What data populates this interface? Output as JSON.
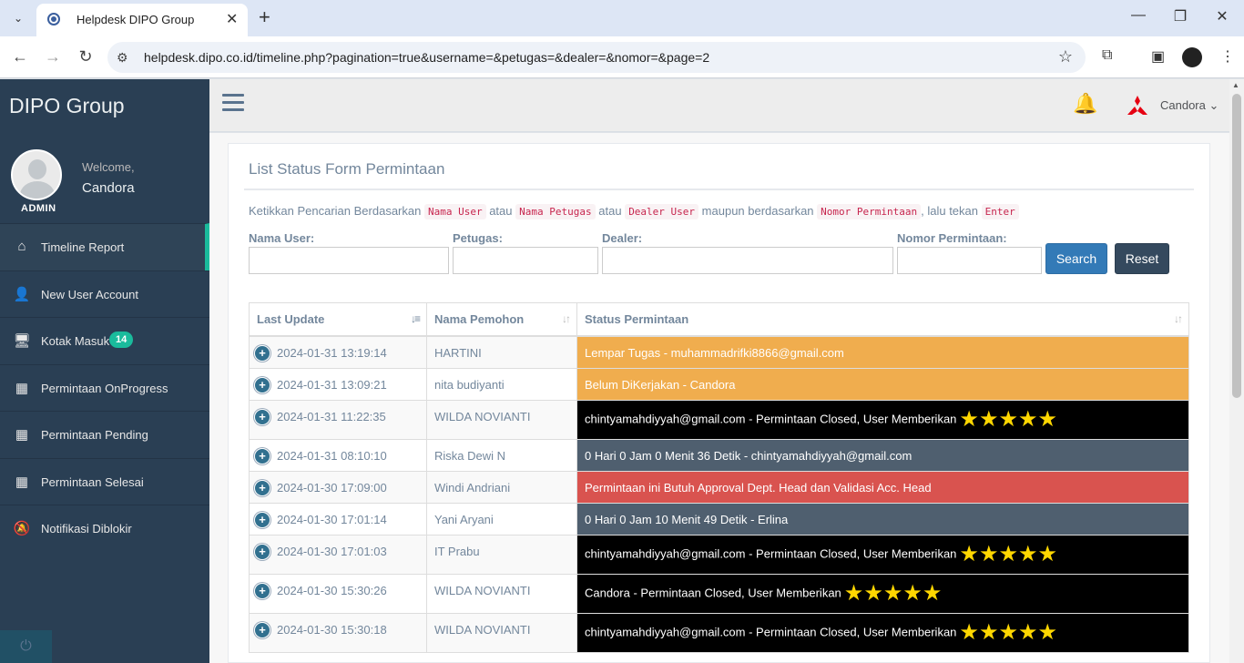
{
  "browser": {
    "tab_title": "Helpdesk DIPO Group",
    "url": "helpdesk.dipo.co.id/timeline.php?pagination=true&username=&petugas=&dealer=&nomor=&page=2"
  },
  "sidebar": {
    "brand": "DIPO Group",
    "welcome": "Welcome,",
    "username": "Candora",
    "role": "ADMIN",
    "items": [
      {
        "label": "Timeline Report",
        "icon": "home-icon",
        "glyph": "⌂"
      },
      {
        "label": "New User Account",
        "icon": "user-plus-icon",
        "glyph": "👤"
      },
      {
        "label": "Kotak Masuk",
        "icon": "desktop-icon",
        "glyph": "🖥",
        "badge": "14"
      },
      {
        "label": "Permintaan OnProgress",
        "icon": "table-icon",
        "glyph": "▦"
      },
      {
        "label": "Permintaan Pending",
        "icon": "table-icon",
        "glyph": "▦"
      },
      {
        "label": "Permintaan Selesai",
        "icon": "table-icon",
        "glyph": "▦"
      },
      {
        "label": "Notifikasi Diblokir",
        "icon": "bell-slash-icon",
        "glyph": "🔕"
      }
    ]
  },
  "topnav": {
    "user": "Candora ⌄"
  },
  "panel": {
    "title": "List Status Form Permintaan",
    "hint_prefix": "Ketikkan Pencarian Berdasarkan",
    "hint_code1": "Nama User",
    "hint_atau1": "atau",
    "hint_code2": "Nama Petugas",
    "hint_atau2": "atau",
    "hint_code3": "Dealer User",
    "hint_maupun": "maupun berdasarkan",
    "hint_code4": "Nomor Permintaan",
    "hint_lalu": ", lalu tekan",
    "hint_code5": "Enter"
  },
  "form": {
    "nama_user_label": "Nama User:",
    "petugas_label": "Petugas:",
    "dealer_label": "Dealer:",
    "nomor_label": "Nomor Permintaan:",
    "search_label": "Search",
    "reset_label": "Reset"
  },
  "table": {
    "columns": [
      "Last Update",
      "Nama Pemohon",
      "Status Permintaan"
    ],
    "rows": [
      {
        "date": "2024-01-31 13:19:14",
        "name": "HARTINI",
        "status": "Lempar Tugas - muhammadrifki8866@gmail.com",
        "color": "#f0ad4e",
        "stars": 0
      },
      {
        "date": "2024-01-31 13:09:21",
        "name": "nita budiyanti",
        "status": "Belum DiKerjakan - Candora",
        "color": "#f0ad4e",
        "stars": 0
      },
      {
        "date": "2024-01-31 11:22:35",
        "name": "WILDA NOVIANTI",
        "status": "chintyamahdiyyah@gmail.com - Permintaan Closed, User Memberikan",
        "color": "#000000",
        "stars": 5
      },
      {
        "date": "2024-01-31 08:10:10",
        "name": "Riska Dewi N",
        "status": "0 Hari 0 Jam 0 Menit 36 Detik - chintyamahdiyyah@gmail.com",
        "color": "#4f5f6f",
        "stars": 0
      },
      {
        "date": "2024-01-30 17:09:00",
        "name": "Windi Andriani",
        "status": "Permintaan ini Butuh Approval Dept. Head dan Validasi Acc. Head",
        "color": "#d9534f",
        "stars": 0
      },
      {
        "date": "2024-01-30 17:01:14",
        "name": "Yani Aryani",
        "status": "0 Hari 0 Jam 10 Menit 49 Detik - Erlina",
        "color": "#4f5f6f",
        "stars": 0
      },
      {
        "date": "2024-01-30 17:01:03",
        "name": "IT Prabu",
        "status": "chintyamahdiyyah@gmail.com - Permintaan Closed, User Memberikan",
        "color": "#000000",
        "stars": 5
      },
      {
        "date": "2024-01-30 15:30:26",
        "name": "WILDA NOVIANTI",
        "status": "Candora - Permintaan Closed, User Memberikan",
        "color": "#000000",
        "stars": 5
      },
      {
        "date": "2024-01-30 15:30:18",
        "name": "WILDA NOVIANTI",
        "status": "chintyamahdiyyah@gmail.com - Permintaan Closed, User Memberikan",
        "color": "#000000",
        "stars": 5
      }
    ]
  }
}
